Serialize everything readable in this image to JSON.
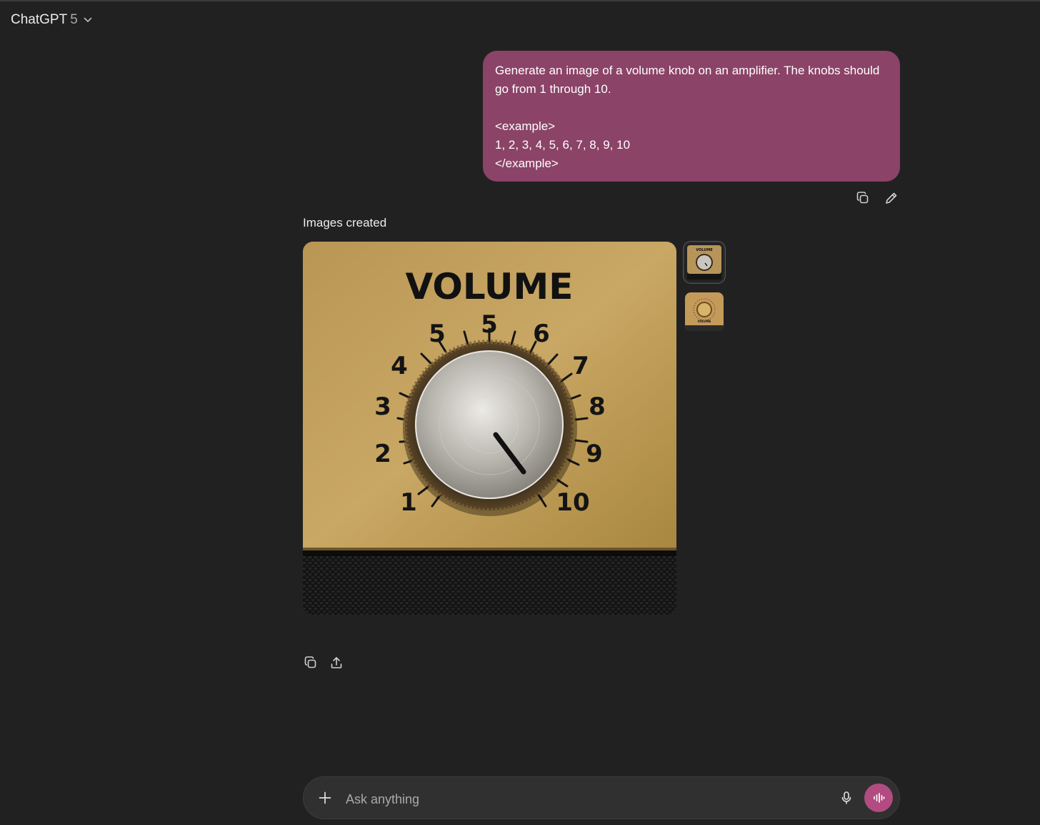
{
  "header": {
    "model_name": "ChatGPT",
    "model_version": "5"
  },
  "user_message": {
    "lines": [
      "Generate an image of a volume knob on an amplifier. The knobs should go from 1 through 10.",
      "",
      "<example>",
      "1, 2, 3, 4, 5, 6, 7, 8, 9, 10",
      "</example>"
    ],
    "color": "#8b4367"
  },
  "response": {
    "label": "Images created",
    "image": {
      "panel_title": "VOLUME",
      "dial_labels": [
        "1",
        "2",
        "3",
        "4",
        "5",
        "5",
        "6",
        "7",
        "8",
        "9",
        "10"
      ]
    },
    "thumbnails": [
      {
        "caption": "VOLUME",
        "selected": true
      },
      {
        "caption": "VOLUME",
        "selected": false
      }
    ]
  },
  "composer": {
    "placeholder": "Ask anything",
    "accent_color": "#b24b80"
  },
  "icons": {
    "model_chevron": "chevron-down-icon",
    "copy": "copy-icon",
    "edit": "pencil-icon",
    "share": "share-icon",
    "add": "plus-icon",
    "mic": "microphone-icon",
    "voice": "voice-waveform-icon"
  }
}
